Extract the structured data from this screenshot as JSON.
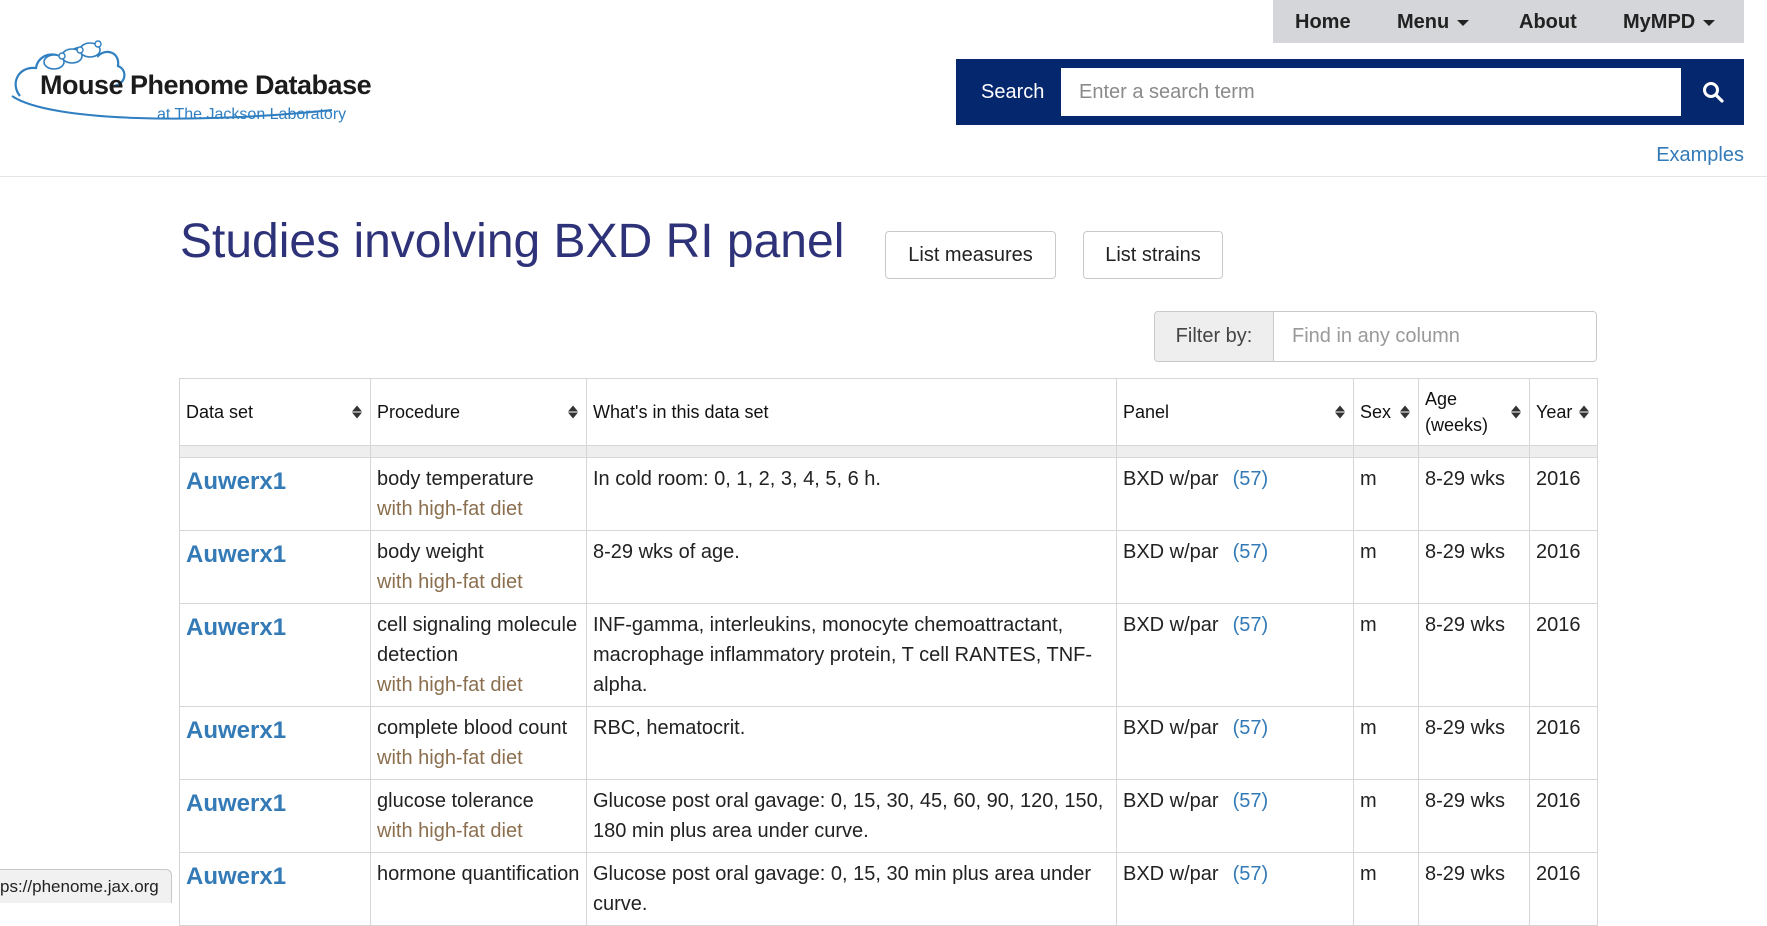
{
  "logo": {
    "line1": "Mouse Phenome Database",
    "line2": "at The Jackson Laboratory"
  },
  "nav": {
    "home": "Home",
    "menu": "Menu",
    "about": "About",
    "mympd": "MyMPD"
  },
  "search": {
    "label": "Search",
    "placeholder": "Enter a search term",
    "examples": "Examples"
  },
  "page": {
    "title": "Studies involving BXD RI panel",
    "btn_measures": "List measures",
    "btn_strains": "List strains"
  },
  "filter": {
    "label": "Filter by:",
    "placeholder": "Find in any column"
  },
  "table": {
    "headers": [
      "Data set",
      "Procedure",
      "What's in this data set",
      "Panel",
      "Sex",
      "Age (weeks)",
      "Year"
    ],
    "rows": [
      {
        "dataset": "Auwerx1",
        "procedure": "body temperature",
        "procedure_sub": "with high-fat diet",
        "desc": "In cold room: 0, 1, 2, 3, 4, 5, 6 h.",
        "panel": "BXD w/par",
        "panel_count": "(57)",
        "sex": "m",
        "age": "8-29 wks",
        "year": "2016"
      },
      {
        "dataset": "Auwerx1",
        "procedure": "body weight",
        "procedure_sub": "with high-fat diet",
        "desc": "8-29 wks of age.",
        "panel": "BXD w/par",
        "panel_count": "(57)",
        "sex": "m",
        "age": "8-29 wks",
        "year": "2016"
      },
      {
        "dataset": "Auwerx1",
        "procedure": "cell signaling molecule detection",
        "procedure_sub": "with high-fat diet",
        "desc": "INF-gamma, interleukins, monocyte chemoattractant, macrophage inflammatory protein, T cell RANTES, TNF-alpha.",
        "panel": "BXD w/par",
        "panel_count": "(57)",
        "sex": "m",
        "age": "8-29 wks",
        "year": "2016"
      },
      {
        "dataset": "Auwerx1",
        "procedure": "complete blood count",
        "procedure_sub": "with high-fat diet",
        "desc": "RBC, hematocrit.",
        "panel": "BXD w/par",
        "panel_count": "(57)",
        "sex": "m",
        "age": "8-29 wks",
        "year": "2016"
      },
      {
        "dataset": "Auwerx1",
        "procedure": "glucose tolerance",
        "procedure_sub": "with high-fat diet",
        "desc": "Glucose post oral gavage: 0, 15, 30, 45, 60, 90, 120, 150, 180 min plus area under curve.",
        "panel": "BXD w/par",
        "panel_count": "(57)",
        "sex": "m",
        "age": "8-29 wks",
        "year": "2016"
      },
      {
        "dataset": "Auwerx1",
        "procedure": "hormone quantification",
        "procedure_sub": "",
        "desc": "Glucose post oral gavage: 0, 15, 30 min plus area under curve.",
        "panel": "BXD w/par",
        "panel_count": "(57)",
        "sex": "m",
        "age": "8-29 wks",
        "year": "2016"
      }
    ]
  },
  "statusbar": {
    "url": "ps://phenome.jax.org"
  },
  "colors": {
    "brand_navy": "#05276e",
    "title": "#2e3278",
    "link": "#337ab7",
    "diet": "#8b6e4e"
  }
}
